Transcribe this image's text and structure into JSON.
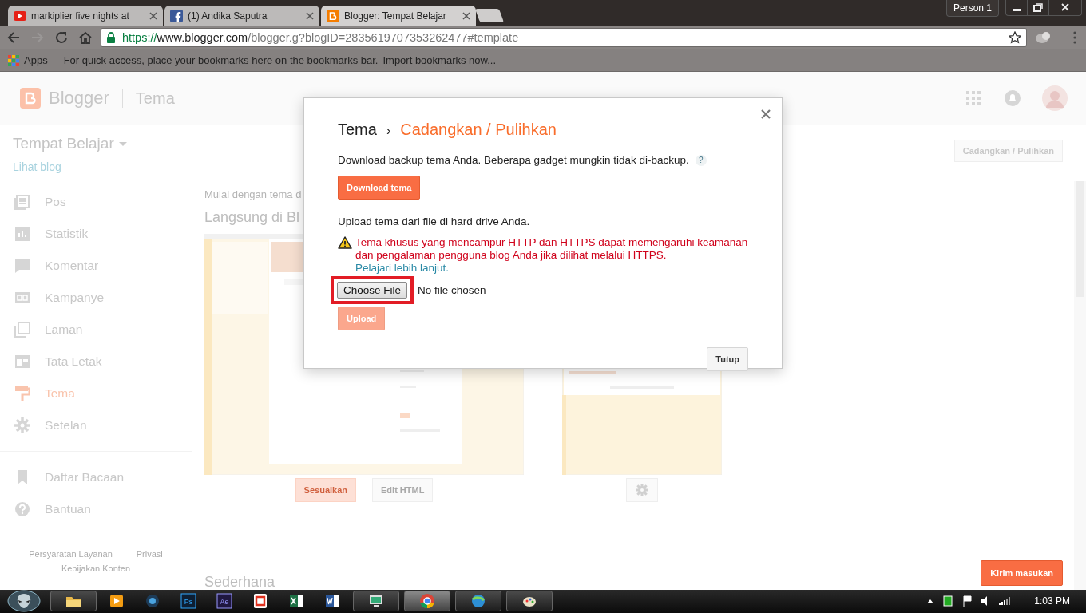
{
  "browser": {
    "tabs": [
      {
        "kind": "youtube",
        "title": "markiplier five nights at",
        "selected": false
      },
      {
        "kind": "facebook",
        "title": "(1) Andika Saputra",
        "selected": false
      },
      {
        "kind": "blogger",
        "title": "Blogger: Tempat Belajar",
        "selected": true
      }
    ],
    "profile": "Person 1",
    "address": {
      "scheme": "https://",
      "host": "www.blogger.com",
      "path": "/blogger.g?blogID=2835619707353262477#template"
    },
    "bookmarks_bar": {
      "apps": "Apps",
      "hint": "For quick access, place your bookmarks here on the bookmarks bar.",
      "link": "Import bookmarks now..."
    }
  },
  "header": {
    "app": "Blogger",
    "section": "Tema"
  },
  "sidebar": {
    "blog_title": "Tempat Belajar",
    "view_blog": "Lihat blog",
    "items": [
      {
        "kind": "posts",
        "label": "Pos",
        "selected": false
      },
      {
        "kind": "stats",
        "label": "Statistik",
        "selected": false
      },
      {
        "kind": "comments",
        "label": "Komentar",
        "selected": false
      },
      {
        "kind": "ads",
        "label": "Kampanye",
        "selected": false
      },
      {
        "kind": "pages",
        "label": "Laman",
        "selected": false
      },
      {
        "kind": "layout",
        "label": "Tata Letak",
        "selected": false
      },
      {
        "kind": "theme",
        "label": "Tema",
        "selected": true
      },
      {
        "kind": "settings",
        "label": "Setelan",
        "selected": false
      }
    ],
    "secondary": [
      {
        "kind": "bookmark",
        "label": "Daftar Bacaan"
      },
      {
        "kind": "help",
        "label": "Bantuan"
      }
    ],
    "footer": [
      "Persyaratan Layanan",
      "Privasi",
      "Kebijakan Konten"
    ]
  },
  "main": {
    "backup_button": "Cadangkan / Pulihkan",
    "intro": "Mulai dengan tema d",
    "live_heading": "Langsung di Bl",
    "theme_buttons": [
      "Sesuaikan",
      "Edit HTML"
    ],
    "simple_heading": "Sederhana",
    "feedback_button": "Kirim masukan"
  },
  "dialog": {
    "crumb": "Tema",
    "separator": "›",
    "title": "Cadangkan / Pulihkan",
    "download_text": "Download backup tema Anda. Beberapa gadget mungkin tidak di-backup.",
    "help": "?",
    "download_button": "Download tema",
    "upload_text": "Upload tema dari file di hard drive Anda.",
    "warning": "Tema khusus yang mencampur HTTP dan HTTPS dapat memengaruhi keamanan dan pengalaman pengguna blog Anda jika dilihat melalui HTTPS.",
    "warning_link": "Pelajari lebih lanjut.",
    "file_button": "Choose File",
    "file_status": "No file chosen",
    "file_highlighted": true,
    "upload_button": "Upload",
    "upload_disabled": true,
    "close_button": "Tutup"
  },
  "taskbar": {
    "apps": [
      {
        "kind": "folder",
        "running": true,
        "selected": false
      },
      {
        "kind": "player",
        "running": false,
        "selected": false
      },
      {
        "kind": "camera",
        "running": false,
        "selected": false
      },
      {
        "kind": "photoshop",
        "label": "Ps",
        "running": false,
        "selected": false
      },
      {
        "kind": "aftereffects",
        "label": "Ae",
        "running": false,
        "selected": false
      },
      {
        "kind": "pdf",
        "running": false,
        "selected": false
      },
      {
        "kind": "excel",
        "running": false,
        "selected": false
      },
      {
        "kind": "word",
        "running": false,
        "selected": false
      },
      {
        "kind": "monitor",
        "running": true,
        "selected": false
      },
      {
        "kind": "chrome",
        "running": true,
        "selected": true
      },
      {
        "kind": "globe",
        "running": true,
        "selected": false
      },
      {
        "kind": "paint",
        "running": true,
        "selected": false
      }
    ],
    "clock": "1:03 PM"
  }
}
